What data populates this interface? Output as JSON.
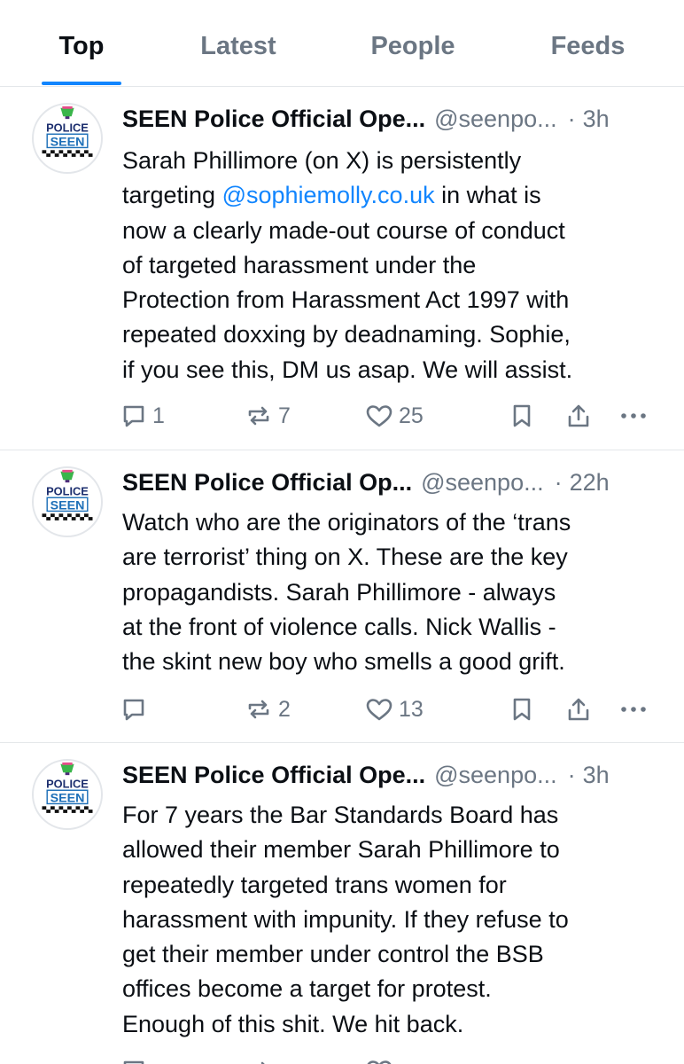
{
  "tabs": [
    {
      "label": "Top",
      "active": true
    },
    {
      "label": "Latest",
      "active": false
    },
    {
      "label": "People",
      "active": false
    },
    {
      "label": "Feeds",
      "active": false
    }
  ],
  "avatar_logo": {
    "line1": "POLICE",
    "line2": "SEEN"
  },
  "posts": [
    {
      "author": "SEEN Police Official Ope...",
      "handle": "@seenpo...",
      "time": "3h",
      "body_pre": "Sarah Phillimore (on X) is persistently\ntargeting ",
      "mention": "@sophiemolly.co.uk",
      "body_post": " in what is\nnow a clearly made-out course of conduct\nof targeted harassment under the\nProtection from Harassment Act 1997 with\nrepeated doxxing by deadnaming.  Sophie,\nif you see this, DM us asap. We will assist.",
      "replies": "1",
      "reposts": "7",
      "likes": "25"
    },
    {
      "author": "SEEN Police Official Op...",
      "handle": "@seenpo...",
      "time": "22h",
      "body_pre": "Watch who are the originators of the ‘trans\nare terrorist’ thing on X.  These are the key\npropagandists.  Sarah Phillimore - always\nat the front of violence calls.  Nick Wallis -\nthe skint new boy who smells a good grift.",
      "mention": "",
      "body_post": "",
      "replies": "",
      "reposts": "2",
      "likes": "13"
    },
    {
      "author": "SEEN Police Official Ope...",
      "handle": "@seenpo...",
      "time": "3h",
      "body_pre": "For 7 years the Bar Standards Board has\nallowed their member Sarah Phillimore to\nrepeatedly targeted trans women for\nharassment with impunity.  If they refuse to\nget their member under control the BSB\noffices become a target for protest.\nEnough of this shit. We hit back.",
      "mention": "",
      "body_post": "",
      "replies": "",
      "reposts": "",
      "likes": ""
    }
  ],
  "colors": {
    "accent": "#1185fe",
    "muted": "#6b7683",
    "text": "#0b0f14",
    "divider": "#e4e7ea"
  },
  "icons": [
    "reply-icon",
    "repost-icon",
    "like-icon",
    "bookmark-icon",
    "share-icon",
    "more-icon"
  ]
}
